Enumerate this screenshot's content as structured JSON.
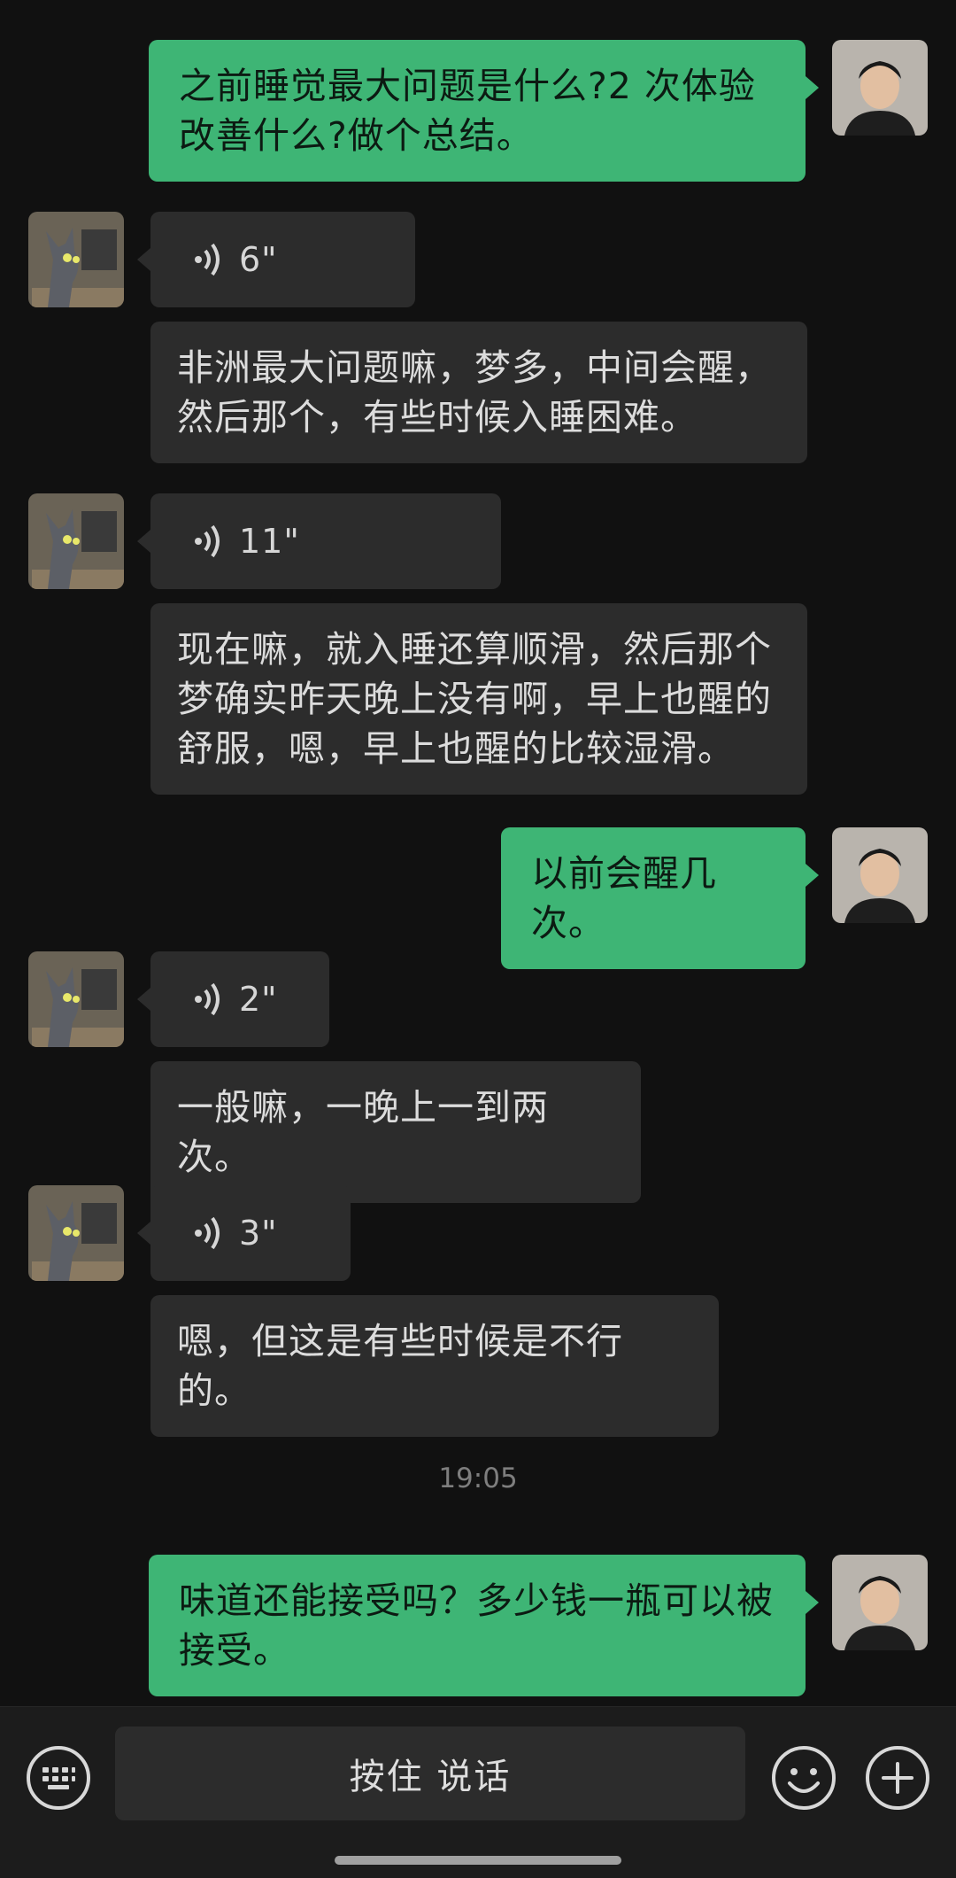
{
  "messages": [
    {
      "from": "me",
      "text": "之前睡觉最大问题是什么?2 次体验改善什么?做个总结。"
    },
    {
      "from": "them",
      "voice_duration": "6\"",
      "transcript": "非洲最大问题嘛，梦多，中间会醒，然后那个，有些时候入睡困难。"
    },
    {
      "from": "them",
      "voice_duration": "11\"",
      "transcript": "现在嘛，就入睡还算顺滑，然后那个梦确实昨天晚上没有啊，早上也醒的舒服，嗯，早上也醒的比较湿滑。"
    },
    {
      "from": "me",
      "text": "以前会醒几次。"
    },
    {
      "from": "them",
      "voice_duration": "2\"",
      "transcript": "一般嘛，一晚上一到两次。"
    },
    {
      "from": "them",
      "voice_duration": "3\"",
      "transcript": "嗯，但这是有些时候是不行的。"
    },
    {
      "from": "me",
      "text": "味道还能接受吗？多少钱一瓶可以被接受。"
    }
  ],
  "timestamp": "19:05",
  "input_bar": {
    "talk_label": "按住 说话"
  },
  "icons": {
    "keyboard": "keyboard-icon",
    "voice": "voice-wave-icon",
    "emoji": "emoji-icon",
    "plus": "plus-icon"
  },
  "colors": {
    "my_bubble": "#3eb575",
    "their_bubble": "#2c2c2c",
    "background": "#111111"
  }
}
